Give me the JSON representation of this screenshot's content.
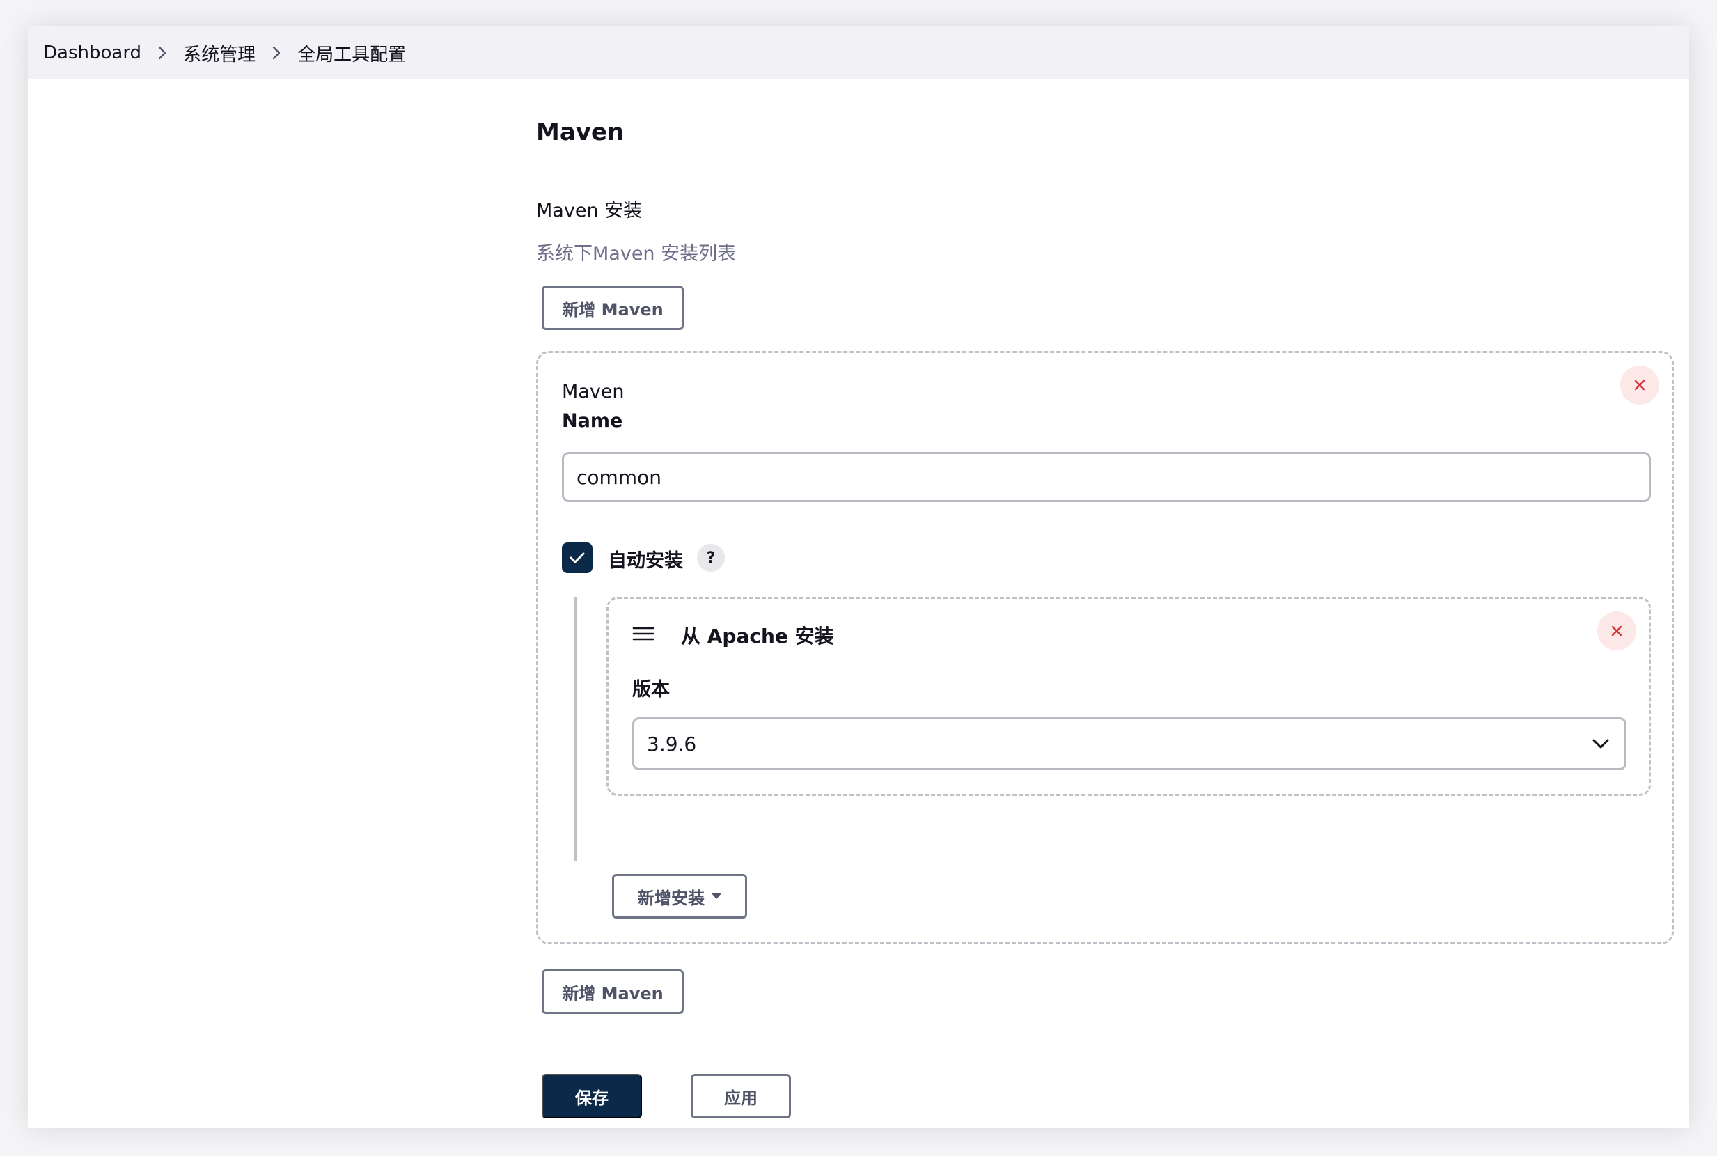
{
  "breadcrumb": {
    "items": [
      "Dashboard",
      "系统管理",
      "全局工具配置"
    ]
  },
  "section": {
    "title": "Maven",
    "subtitle": "Maven 安装",
    "description": "系统下Maven 安装列表",
    "add_button_label": "新增 Maven"
  },
  "installation": {
    "card_title": "Maven",
    "name_label": "Name",
    "name_value": "common",
    "auto_install_label": "自动安装",
    "auto_install_checked": true,
    "help_label": "?",
    "installer": {
      "title": "从 Apache 安装",
      "version_label": "版本",
      "version_value": "3.9.6"
    },
    "add_installer_label": "新增安装"
  },
  "footer": {
    "add_button_label": "新增 Maven",
    "save_label": "保存",
    "apply_label": "应用"
  },
  "colors": {
    "primary": "#0b2a4a",
    "close_bg": "#fde8e8",
    "close_icon": "#d3323a",
    "breadcrumb_bg": "#f2f2f6",
    "description": "#6e6e8a"
  },
  "icons": [
    "chevron-right-icon",
    "close-icon",
    "check-icon",
    "help-icon",
    "drag-handle-icon",
    "chevron-down-icon",
    "caret-down-icon"
  ]
}
